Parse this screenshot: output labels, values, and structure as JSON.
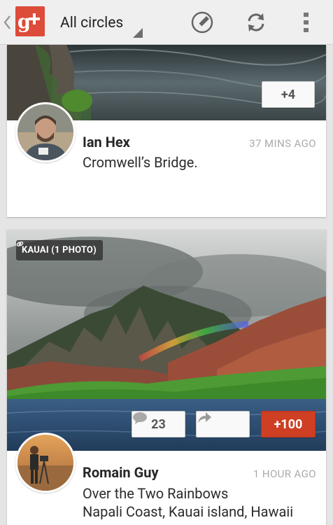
{
  "action_bar": {
    "circles_label": "All circles",
    "up_icon": "chevron-left-icon",
    "logo_icon": "google-plus-logo",
    "compose_icon": "pencil-icon",
    "refresh_icon": "refresh-icon",
    "overflow_icon": "overflow-menu-icon"
  },
  "posts": [
    {
      "author": "Ian Hex",
      "timestamp": "37 MINS AGO",
      "text_lines": [
        "Cromwell’s Bridge."
      ],
      "photo_badge": "+4"
    },
    {
      "album_label": "KAUAI (1 PHOTO)",
      "comment_count": "23",
      "plus_one_label": "+100",
      "author": "Romain Guy",
      "timestamp": "1 HOUR AGO",
      "text_lines": [
        "Over the Two Rainbows",
        "Napali Coast, Kauai island, Hawaii"
      ]
    }
  ],
  "colors": {
    "brand_red": "#dd4b39",
    "plus_one_active": "#cf3f23",
    "action_bar_bg": "#efefef",
    "stream_bg": "#e5e5e5"
  }
}
